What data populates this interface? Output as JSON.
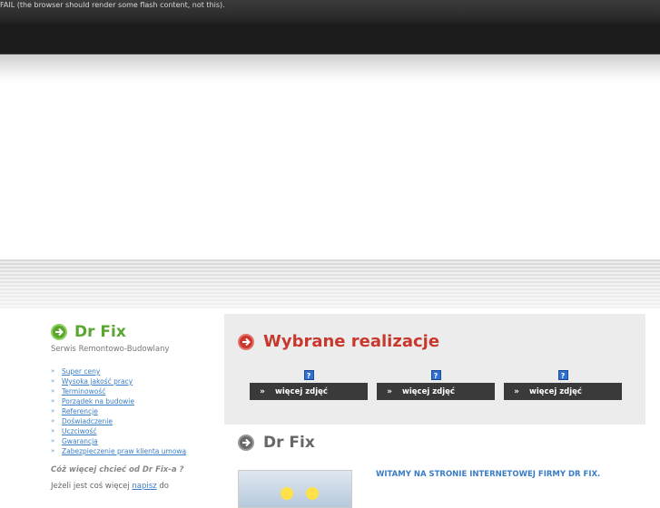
{
  "flash_fail": "FAIL (the browser should render some flash content, not this).",
  "brand": {
    "title": "Dr Fix",
    "subtitle": "Serwis Remontowo-Budowlany",
    "color": "#5aa630"
  },
  "features": [
    "Super ceny",
    "Wysoka jakość pracy",
    "Terminowość",
    "Porządek na budowie",
    "Referencje",
    "Doświadczenie",
    "Uczciwość",
    "Gwarancja",
    "Zabezpieczenie praw klienta umową"
  ],
  "question": "Cóż więcej chcieć od Dr Fix-a ?",
  "para": {
    "before": "Jeżeli jest coś więcej ",
    "link": "napisz",
    "after": " do"
  },
  "realizations": {
    "title": "Wybrane realizacje",
    "color": "#c8382d",
    "icon": "question-icon",
    "items": [
      {
        "icon_text": "?",
        "arrow": "»",
        "label": "więcej zdjęć"
      },
      {
        "icon_text": "?",
        "arrow": "»",
        "label": "więcej zdjęć"
      },
      {
        "icon_text": "?",
        "arrow": "»",
        "label": "więcej zdjęć"
      }
    ]
  },
  "section": {
    "title": "Dr Fix",
    "welcome": "WITAMY NA STRONIE INTERNETOWEJ FIRMY DR FIX."
  }
}
